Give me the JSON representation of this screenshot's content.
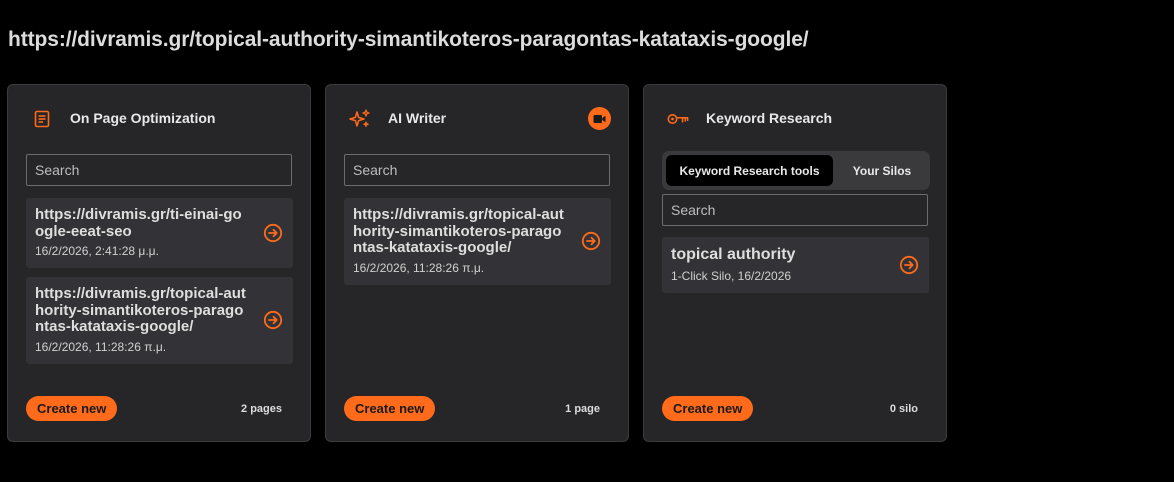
{
  "page": {
    "url": "https://divramis.gr/topical-authority-simantikoteros-paragontas-katataxis-google/"
  },
  "theme": {
    "accent": "#ff6b1a",
    "card_bg": "#262628",
    "item_bg": "#333337"
  },
  "cards": [
    {
      "title": "On Page Optimization",
      "icon": "document-icon",
      "search_placeholder": "Search",
      "items": [
        {
          "title": "https://divramis.gr/ti-einai-google-eeat-seo",
          "date": "16/2/2026, 2:41:28 μ.μ."
        },
        {
          "title": "https://divramis.gr/topical-authority-simantikoteros-paragontas-katataxis-google/",
          "date": "16/2/2026, 11:28:26 π.μ."
        }
      ],
      "create_label": "Create new",
      "count": "2 pages"
    },
    {
      "title": "AI Writer",
      "icon": "sparkles-icon",
      "video_icon": "video-camera-icon",
      "search_placeholder": "Search",
      "items": [
        {
          "title": "https://divramis.gr/topical-authority-simantikoteros-paragontas-katataxis-google/",
          "date": "16/2/2026, 11:28:26 π.μ."
        }
      ],
      "create_label": "Create new",
      "count": "1 page"
    },
    {
      "title": "Keyword Research",
      "icon": "key-icon",
      "tabs": [
        {
          "label": "Keyword Research tools",
          "active": true
        },
        {
          "label": "Your Silos",
          "active": false
        }
      ],
      "search_placeholder": "Search",
      "items": [
        {
          "title": "topical authority",
          "date": "1-Click Silo, 16/2/2026"
        }
      ],
      "create_label": "Create new",
      "count": "0 silo"
    }
  ]
}
